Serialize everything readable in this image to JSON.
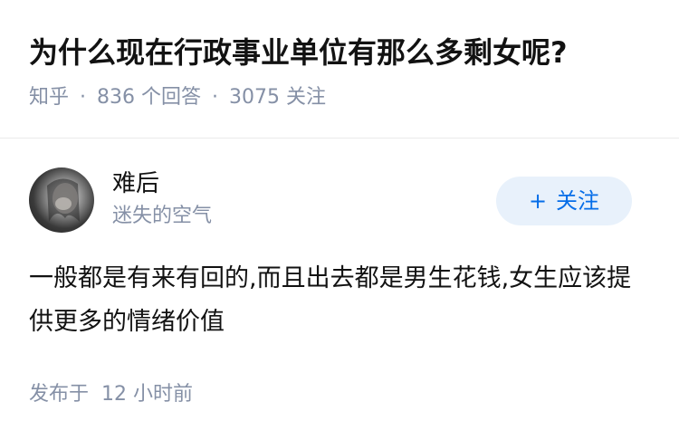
{
  "question": {
    "title": "为什么现在行政事业单位有那么多剩女呢?",
    "source": "知乎",
    "separator": "·",
    "answers_count": "836",
    "answers_label": "个回答",
    "followers_count": "3075",
    "followers_label": "关注"
  },
  "author": {
    "name": "难后",
    "bio": "迷失的空气",
    "avatar_icon": "avatar-photo"
  },
  "follow_button": {
    "plus": "+",
    "label": "关注"
  },
  "answer": {
    "content": "一般都是有来有回的,而且出去都是男生花钱,女生应该提供更多的情绪价值"
  },
  "footer": {
    "published_label": "发布于",
    "time_ago": "12 小时前"
  },
  "colors": {
    "title": "#121212",
    "muted": "#8590a6",
    "accent": "#056de8",
    "follow_bg": "#e8f1fb"
  }
}
